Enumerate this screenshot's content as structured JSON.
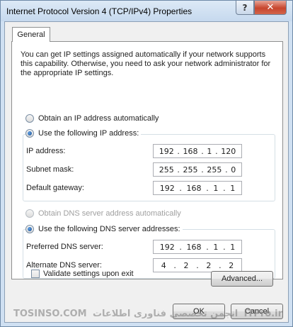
{
  "window": {
    "title": "Internet Protocol Version 4 (TCP/IPv4) Properties",
    "help_glyph": "?",
    "close_glyph": "✕"
  },
  "tabs": [
    {
      "label": "General",
      "selected": true
    }
  ],
  "intro_text": "You can get IP settings assigned automatically if your network supports this capability. Otherwise, you need to ask your network administrator for the appropriate IP settings.",
  "ip_section": {
    "auto_label": "Obtain an IP address automatically",
    "manual_label": "Use the following IP address:",
    "selected": "manual",
    "fields": [
      {
        "label": "IP address:",
        "octets": [
          "192",
          "168",
          "1",
          "120"
        ]
      },
      {
        "label": "Subnet mask:",
        "octets": [
          "255",
          "255",
          "255",
          "0"
        ]
      },
      {
        "label": "Default gateway:",
        "octets": [
          "192",
          "168",
          "1",
          "1"
        ]
      }
    ]
  },
  "dns_section": {
    "auto_label": "Obtain DNS server address automatically",
    "auto_disabled": true,
    "manual_label": "Use the following DNS server addresses:",
    "selected": "manual",
    "fields": [
      {
        "label": "Preferred DNS server:",
        "octets": [
          "192",
          "168",
          "1",
          "1"
        ]
      },
      {
        "label": "Alternate DNS server:",
        "octets": [
          "4",
          "2",
          "2",
          "2"
        ]
      }
    ]
  },
  "validate_label": "Validate settings upon exit",
  "validate_checked": false,
  "buttons": {
    "advanced": "Advanced...",
    "ok": "OK",
    "cancel": "Cancel"
  },
  "watermark": {
    "left": "TOSINSO.COM",
    "middle": "انجمن تخصصی فناوری اطلاعات",
    "right": "ITPro.ir"
  }
}
